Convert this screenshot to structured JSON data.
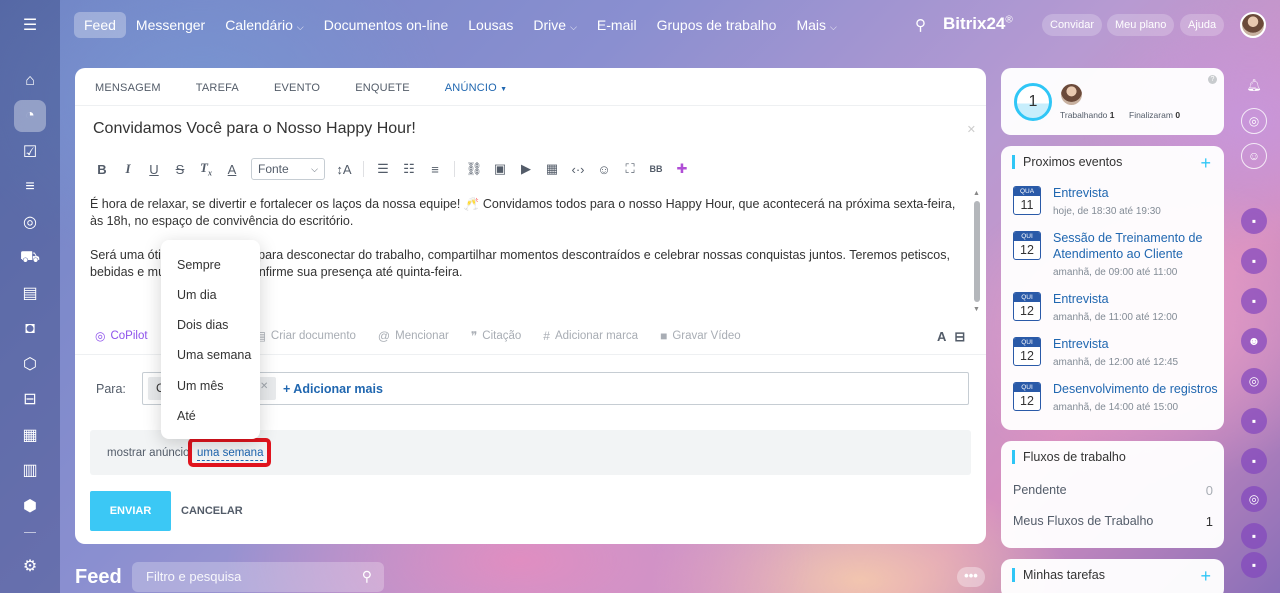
{
  "nav": {
    "items": [
      {
        "label": "Feed",
        "active": true,
        "caret": false
      },
      {
        "label": "Messenger",
        "caret": false
      },
      {
        "label": "Calendário",
        "caret": true
      },
      {
        "label": "Documentos on-line",
        "caret": false
      },
      {
        "label": "Lousas",
        "caret": false
      },
      {
        "label": "Drive",
        "caret": true
      },
      {
        "label": "E-mail",
        "caret": false
      },
      {
        "label": "Grupos de trabalho",
        "caret": false
      },
      {
        "label": "Mais",
        "caret": true
      }
    ],
    "brand": "Bitrix24",
    "brand_sup": "®",
    "invite_label": "Convidar",
    "plan_label": "Meu plano",
    "help_label": "Ajuda"
  },
  "composer": {
    "tabs": [
      "MENSAGEM",
      "TAREFA",
      "EVENTO",
      "ENQUETE",
      "ANÚNCIO"
    ],
    "active_tab": "ANÚNCIO",
    "title": "Convidamos Você para o Nosso Happy Hour!",
    "font_select": "Fonte",
    "body": [
      "É hora de relaxar, se divertir e fortalecer os laços da nossa equipe! 🥂 Convidamos todos para o nosso Happy Hour, que acontecerá na próxima sexta-feira, às 18h, no espaço de convivência do escritório.",
      "Será uma ótima oportunidade para desconectar do trabalho, compartilhar momentos descontraídos e celebrar nossas conquistas juntos. Teremos petiscos, bebidas e muita animação! Confirme sua presença até quinta-feira."
    ],
    "actions": {
      "copilot": "CoPilot",
      "create_doc": "Criar documento",
      "mention": "Mencionar",
      "quote": "Citação",
      "tag": "Adicionar marca",
      "record": "Gravar Vídeo"
    },
    "to_label": "Para:",
    "recipient_chip": "C",
    "add_more": "+ Adicionar mais",
    "show_label": "mostrar anúncio:",
    "show_value": "uma semana",
    "send": "ENVIAR",
    "cancel": "CANCELAR"
  },
  "dropdown": {
    "options": [
      "Sempre",
      "Um dia",
      "Dois dias",
      "Uma semana",
      "Um mês",
      "Até"
    ]
  },
  "feed": {
    "title": "Feed",
    "search_placeholder": "Filtro e pesquisa",
    "more": "•••"
  },
  "status_widget": {
    "count": "1",
    "working_label": "Trabalhando",
    "working_count": "1",
    "finished_label": "Finalizaram",
    "finished_count": "0"
  },
  "events_widget": {
    "title": "Proximos eventos",
    "events": [
      {
        "weekday": "QUA",
        "day": "11",
        "title": "Entrevista",
        "time": "hoje, de 18:30 até 19:30"
      },
      {
        "weekday": "QUI",
        "day": "12",
        "title": "Sessão de Treinamento de Atendimento ao Cliente",
        "time": "amanhã, de 09:00 até 11:00"
      },
      {
        "weekday": "QUI",
        "day": "12",
        "title": "Entrevista",
        "time": "amanhã, de 11:00 até 12:00"
      },
      {
        "weekday": "QUI",
        "day": "12",
        "title": "Entrevista",
        "time": "amanhã, de 12:00 até 12:45"
      },
      {
        "weekday": "QUI",
        "day": "12",
        "title": "Desenvolvimento de registros",
        "time": "amanhã, de 14:00 até 15:00"
      }
    ]
  },
  "flows_widget": {
    "title": "Fluxos de trabalho",
    "rows": [
      {
        "label": "Pendente",
        "count": "0"
      },
      {
        "label": "Meus Fluxos de Trabalho",
        "count": "1"
      }
    ]
  },
  "tasks_widget": {
    "title": "Minhas tarefas"
  },
  "colors": {
    "accent": "#2fc6f6",
    "link": "#2067b0",
    "send_button": "#3bc8f5",
    "highlight": "#e0141e"
  }
}
